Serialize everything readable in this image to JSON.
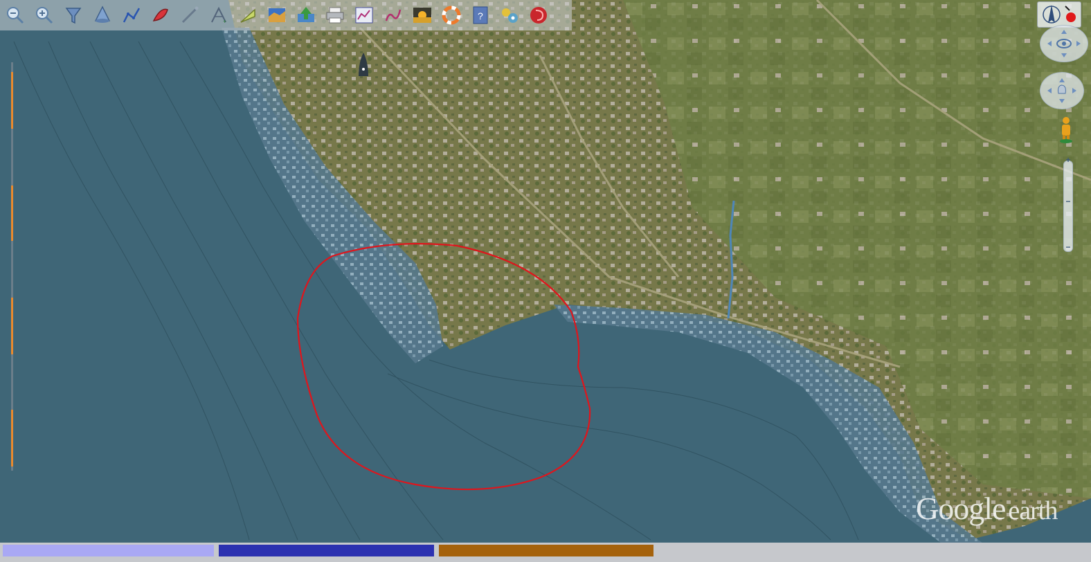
{
  "toolbar": {
    "tools": [
      {
        "name": "zoom-out-icon"
      },
      {
        "name": "zoom-in-icon"
      },
      {
        "name": "filter-icon"
      },
      {
        "name": "cone-icon"
      },
      {
        "name": "polyline-icon"
      },
      {
        "name": "boat-icon"
      },
      {
        "name": "measure-icon"
      },
      {
        "name": "angle-icon"
      },
      {
        "name": "sector-icon"
      },
      {
        "name": "terrain-icon"
      },
      {
        "name": "upload-icon"
      },
      {
        "name": "print-icon"
      },
      {
        "name": "chart-icon"
      },
      {
        "name": "route-icon"
      },
      {
        "name": "sunset-icon"
      },
      {
        "name": "lifebuoy-icon"
      },
      {
        "name": "help-icon"
      },
      {
        "name": "settings-icon"
      },
      {
        "name": "record-icon"
      }
    ]
  },
  "navigation": {
    "compass_icon": "compass-icon",
    "look_icon": "look-around-icon",
    "move_icon": "move-icon",
    "streetview_icon": "pegman-icon",
    "zoom_in_label": "+",
    "zoom_mid_label": "−",
    "zoom_out_label": "−"
  },
  "watermark": {
    "brand": "Google",
    "product": "earth"
  },
  "annotation": {
    "color": "#e0151c",
    "shape": "freehand-circle"
  },
  "status_bar": {
    "segments": [
      {
        "color": "#a9a8f4"
      },
      {
        "color": "#2c31b0"
      },
      {
        "color": "#a5620c"
      }
    ]
  },
  "colors": {
    "water": "#3f6677",
    "land": "#7b7a4a",
    "shore": "#6f8fa3"
  }
}
